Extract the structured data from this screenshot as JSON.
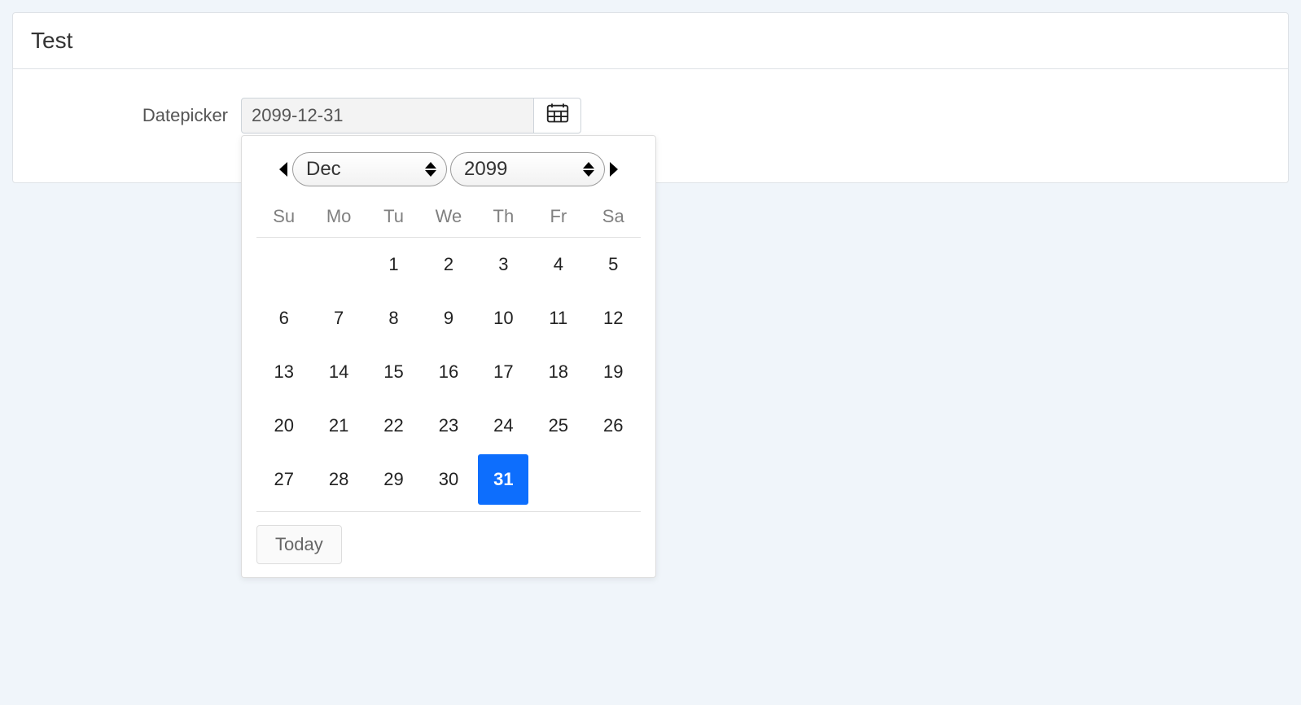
{
  "panel": {
    "title": "Test"
  },
  "form": {
    "label": "Datepicker",
    "value": "2099-12-31"
  },
  "datepicker": {
    "month": "Dec",
    "year": "2099",
    "weekdays": [
      "Su",
      "Mo",
      "Tu",
      "We",
      "Th",
      "Fr",
      "Sa"
    ],
    "weeks": [
      [
        "",
        "",
        "1",
        "2",
        "3",
        "4",
        "5"
      ],
      [
        "6",
        "7",
        "8",
        "9",
        "10",
        "11",
        "12"
      ],
      [
        "13",
        "14",
        "15",
        "16",
        "17",
        "18",
        "19"
      ],
      [
        "20",
        "21",
        "22",
        "23",
        "24",
        "25",
        "26"
      ],
      [
        "27",
        "28",
        "29",
        "30",
        "31",
        "",
        ""
      ]
    ],
    "selected_day": "31",
    "today_label": "Today"
  }
}
